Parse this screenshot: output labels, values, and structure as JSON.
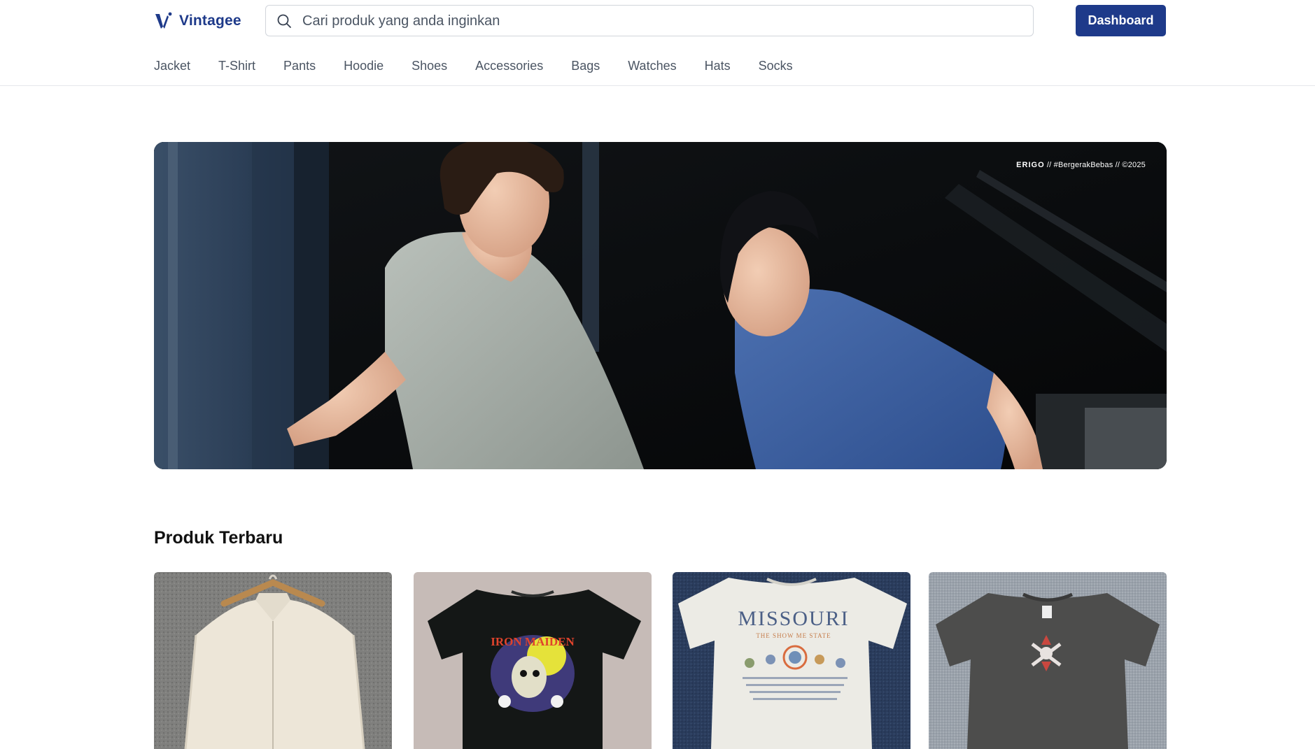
{
  "header": {
    "brand_name": "Vintagee",
    "logo_icon": "vintagee-logo-icon",
    "search": {
      "placeholder": "Cari produk yang anda inginkan",
      "value": "",
      "icon": "search-icon"
    },
    "dashboard_label": "Dashboard",
    "accent_color": "#1e3a8a"
  },
  "nav": {
    "items": [
      {
        "label": "Jacket"
      },
      {
        "label": "T-Shirt"
      },
      {
        "label": "Pants"
      },
      {
        "label": "Hoodie"
      },
      {
        "label": "Shoes"
      },
      {
        "label": "Accessories"
      },
      {
        "label": "Bags"
      },
      {
        "label": "Watches"
      },
      {
        "label": "Hats"
      },
      {
        "label": "Socks"
      }
    ]
  },
  "hero": {
    "caption_brand": "ERIGO",
    "caption_rest": " // #BergerakBebas // ©2025"
  },
  "latest": {
    "title": "Produk Terbaru",
    "products": [
      {
        "image": "cream-zip-jacket-photo"
      },
      {
        "image": "iron-maiden-black-tshirt-photo",
        "print_text": "IRON MAIDEN"
      },
      {
        "image": "missouri-white-tshirt-photo",
        "print_text": "MISSOURI",
        "print_subtext": "THE SHOW ME STATE"
      },
      {
        "image": "grey-skull-tshirt-photo"
      }
    ]
  }
}
